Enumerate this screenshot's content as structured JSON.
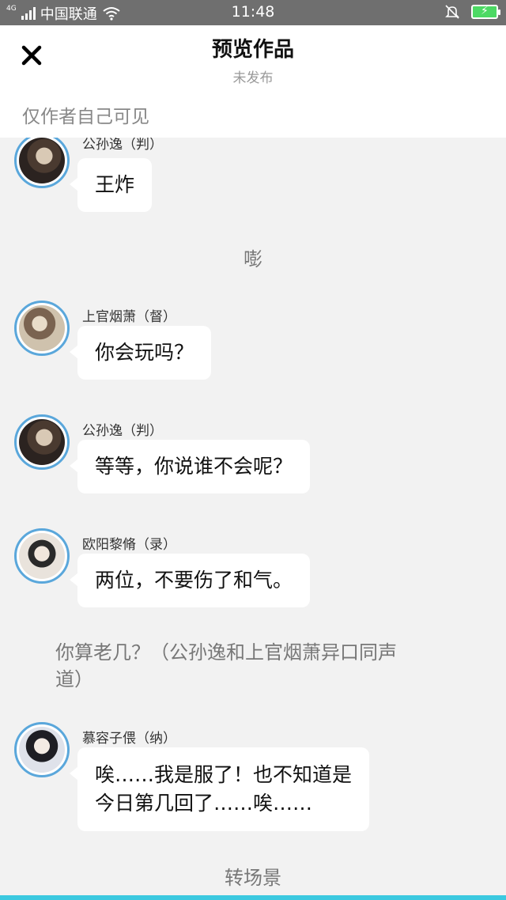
{
  "status_bar": {
    "network": "4G",
    "carrier": "中国联通",
    "time": "11:48"
  },
  "header": {
    "title": "预览作品",
    "subtitle": "未发布",
    "visibility_note": "仅作者自己可见"
  },
  "messages": [
    {
      "speaker": "公孙逸（判）",
      "text": "王炸"
    },
    {
      "center": "嘭"
    },
    {
      "speaker": "上官烟萧（督）",
      "text": "你会玩吗？"
    },
    {
      "speaker": "公孙逸（判）",
      "text": "等等，你说谁不会呢？"
    },
    {
      "speaker": "欧阳黎脩（录）",
      "text": "两位，不要伤了和气。"
    },
    {
      "narration_line1": "你算老几？（公孙逸和上官烟萧异口同声",
      "narration_line2": "道）"
    },
    {
      "speaker": "慕容子偎（纳）",
      "text_line1": "唉……我是服了！也不知道是",
      "text_line2": "今日第几回了……唉……"
    },
    {
      "center": "转场景"
    }
  ],
  "colors": {
    "status_bar_bg": "#6f6f6f",
    "avatar_ring": "#5aa7db",
    "battery": "#4cd964",
    "bottom_accent": "#3cc9e0"
  },
  "icons": [
    "signal-icon",
    "wifi-icon",
    "mute-bell-icon",
    "battery-icon",
    "close-icon"
  ]
}
